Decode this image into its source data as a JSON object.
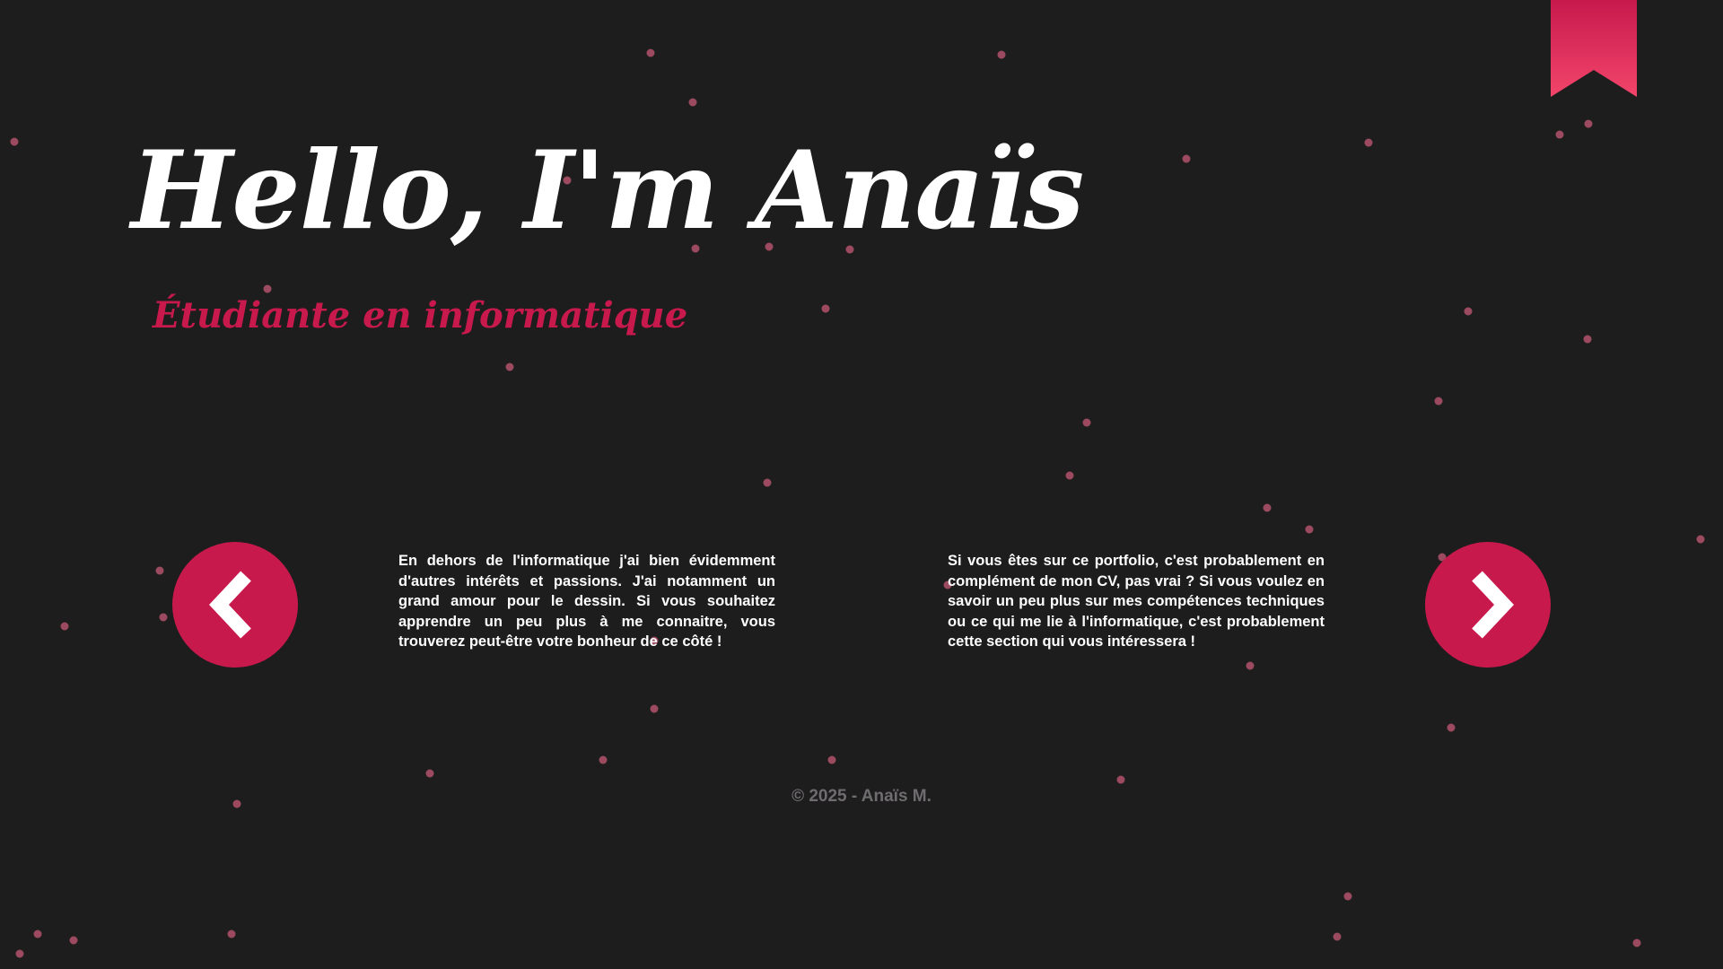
{
  "hero": {
    "title": "Hello, I'm Anaïs",
    "subtitle": "Étudiante en informatique"
  },
  "nav": {
    "left": {
      "icon": "chevron-left-icon"
    },
    "right": {
      "icon": "chevron-right-icon"
    }
  },
  "sections": {
    "left_text": "En dehors de l'informatique j'ai bien évidemment d'autres intérêts et passions. J'ai notamment un grand amour pour le dessin. Si vous souhaitez apprendre un peu plus à me connaitre, vous trouverez peut-être votre bonheur de ce côté !",
    "right_text": "Si vous êtes sur ce portfolio, c'est probablement en complément de mon CV, pas vrai ? Si vous voulez en savoir un peu plus sur mes compétences techniques ou ce qui me lie à l'informatique, c'est probablement cette section qui vous intéressera !"
  },
  "footer": {
    "copyright": "© 2025 - Anaïs M."
  },
  "decor": {
    "bookmark_icon": "bookmark-ribbon-icon",
    "particles_icon": "particle-dots"
  },
  "colors": {
    "background": "#1e1d1e",
    "accent": "#c8194d",
    "particle": "#a34d63",
    "footer_text": "#6f6c6f"
  }
}
